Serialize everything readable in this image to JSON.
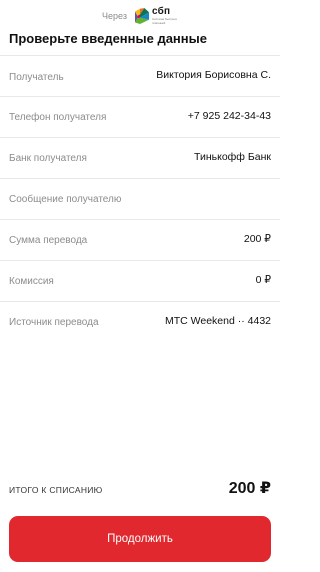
{
  "header": {
    "via_text": "Через",
    "logo_name": "сбп",
    "logo_subtext": "Система быстрых платежей"
  },
  "page_title": "Проверьте введенные данные",
  "details": [
    {
      "label": "Получатель",
      "value": "Виктория Борисовна С."
    },
    {
      "label": "Телефон получателя",
      "value": "+7 925 242-34-43"
    },
    {
      "label": "Банк получателя",
      "value": "Тинькофф Банк"
    },
    {
      "label": "Сообщение получателю",
      "value": ""
    },
    {
      "label": "Сумма перевода",
      "value": "200 ₽"
    },
    {
      "label": "Комиссия",
      "value": "0 ₽"
    },
    {
      "label": "Источник перевода",
      "value": "МТС Weekend ·· 4432"
    }
  ],
  "total": {
    "label": "итого к списанию",
    "value": "200 ₽"
  },
  "continue_button": {
    "label": "Продолжить",
    "color": "#e0282e"
  },
  "sbp_colors": [
    "#5b57a2",
    "#d90751",
    "#fab91d",
    "#0f754e",
    "#ed6f26",
    "#63b22f",
    "#1487c9"
  ]
}
